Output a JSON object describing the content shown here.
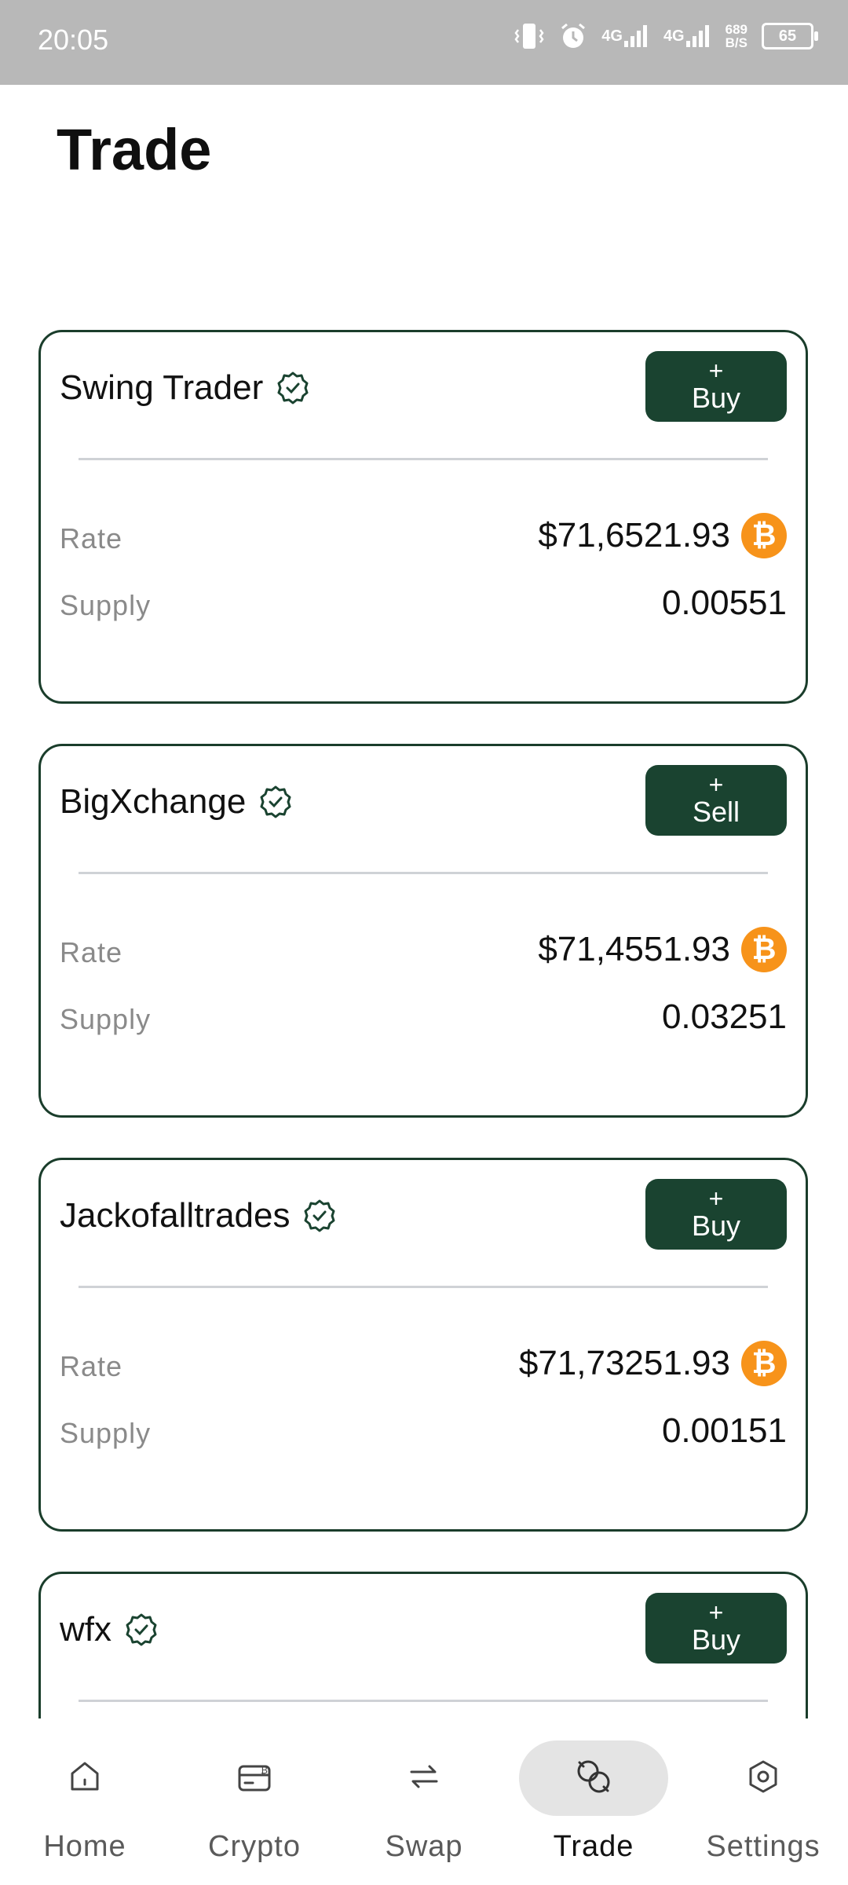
{
  "status_bar": {
    "time": "20:05",
    "network1": "4G",
    "network2": "4G",
    "speed_value": "689",
    "speed_unit": "B/S",
    "battery": "65"
  },
  "page": {
    "title": "Trade"
  },
  "trades": [
    {
      "name": "Swing Trader",
      "action": "Buy",
      "rate_label": "Rate",
      "rate": "$71,6521.93",
      "supply_label": "Supply",
      "supply": "0.00551"
    },
    {
      "name": "BigXchange",
      "action": "Sell",
      "rate_label": "Rate",
      "rate": "$71,4551.93",
      "supply_label": "Supply",
      "supply": "0.03251"
    },
    {
      "name": "Jackofalltrades",
      "action": "Buy",
      "rate_label": "Rate",
      "rate": "$71,73251.93",
      "supply_label": "Supply",
      "supply": "0.00151"
    },
    {
      "name": "wfx",
      "action": "Buy"
    }
  ],
  "button_plus": "+",
  "bottom_nav": [
    {
      "label": "Home",
      "icon": "home-icon",
      "active": false
    },
    {
      "label": "Crypto",
      "icon": "crypto-wallet-icon",
      "active": false
    },
    {
      "label": "Swap",
      "icon": "swap-icon",
      "active": false
    },
    {
      "label": "Trade",
      "icon": "trade-icon",
      "active": true
    },
    {
      "label": "Settings",
      "icon": "settings-icon",
      "active": false
    }
  ],
  "colors": {
    "accent": "#1a4330",
    "card_border": "#1a3d2b",
    "bitcoin": "#f7931a",
    "status_bar": "#b8b8b8",
    "active_nav_bg": "#e4e4e4"
  }
}
